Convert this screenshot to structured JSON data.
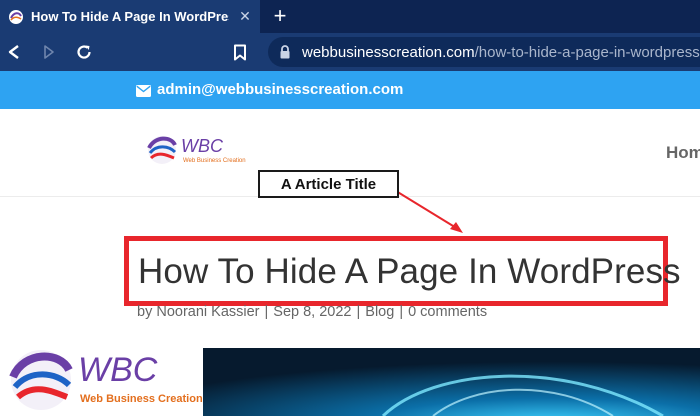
{
  "browser": {
    "tab_title": "How To Hide A Page In WordPress",
    "tab_close_icon": "close-icon",
    "new_tab_label": "+",
    "url_domain": "webbusinesscreation.com",
    "url_path": "/how-to-hide-a-page-in-wordpress"
  },
  "site": {
    "topbar_email": "admin@webbusinesscreation.com",
    "logo_text": "WBC",
    "logo_subtext": "Web Business Creation",
    "menu_home": "Home"
  },
  "annotation": {
    "callout": "A Article Title",
    "color": "#e8262c"
  },
  "post": {
    "title": "How To Hide A Page In WordPress",
    "author": "by Noorani Kassier",
    "date": "Sep 8, 2022",
    "category": "Blog",
    "comments": "0 comments",
    "separator": "|"
  },
  "colors": {
    "browser_tab_strip": "#0d2452",
    "browser_toolbar": "#1a3b73",
    "topbar": "#2ea3f2",
    "logo_purple": "#6a3fa6",
    "logo_orange": "#e36f1e"
  }
}
